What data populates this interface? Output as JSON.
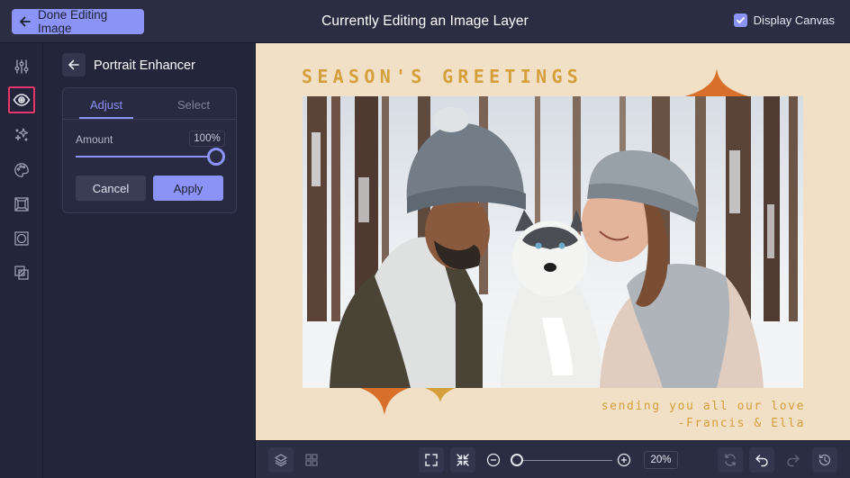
{
  "header": {
    "done_label": "Done Editing Image",
    "title": "Currently Editing an Image Layer",
    "display_canvas_label": "Display Canvas",
    "display_canvas_checked": true
  },
  "rail": {
    "items": [
      {
        "icon": "sliders-icon",
        "active": false
      },
      {
        "icon": "eye-icon",
        "active": true
      },
      {
        "icon": "sparkle-icon",
        "active": false
      },
      {
        "icon": "palette-icon",
        "active": false
      },
      {
        "icon": "frame-icon",
        "active": false
      },
      {
        "icon": "shape-crop-icon",
        "active": false
      },
      {
        "icon": "overlay-icon",
        "active": false
      }
    ]
  },
  "panel": {
    "title": "Portrait Enhancer",
    "tabs": [
      {
        "label": "Adjust",
        "active": true
      },
      {
        "label": "Select",
        "active": false
      }
    ],
    "amount_label": "Amount",
    "amount_value": "100%",
    "amount_fraction": 1.0,
    "cancel_label": "Cancel",
    "apply_label": "Apply"
  },
  "canvas": {
    "greeting": "SEASON'S GREETINGS",
    "message_line1": "sending you all our love",
    "message_line2": "-Francis & Ella",
    "photo_description": "couple in knit hats hugging a husky in snowy forest"
  },
  "footer": {
    "zoom_value": "20%",
    "zoom_fraction": 0.0
  },
  "colors": {
    "accent": "#8b93f7",
    "canvas_bg": "#f1dfc6",
    "gold_text": "#d5a03b",
    "orange_ornament": "#d9702a",
    "active_outline": "#e8356c"
  }
}
